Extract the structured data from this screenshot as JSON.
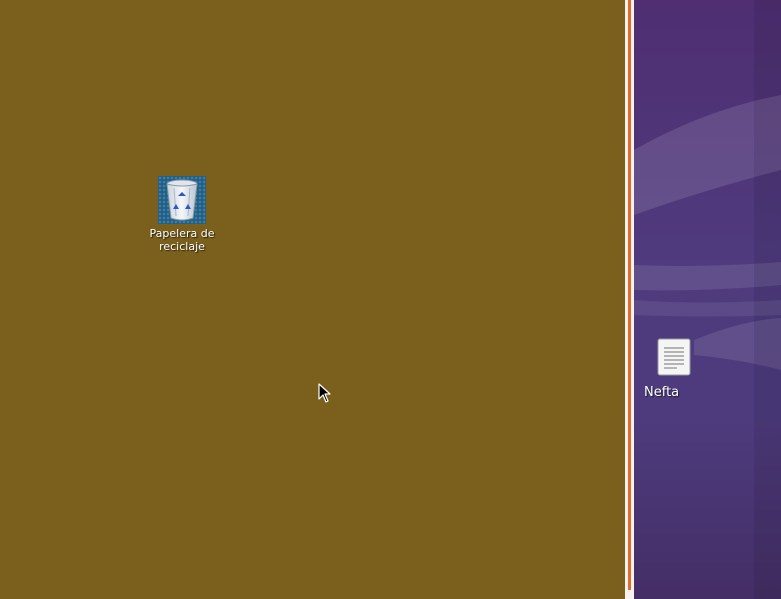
{
  "vm_desktop": {
    "background_color": "#7a5f1d",
    "icons": [
      {
        "label": "Papelera de reciclaje",
        "icon": "recycle-bin-icon"
      }
    ]
  },
  "host_desktop": {
    "background_color": "#4f3b7e",
    "accent_color": "#e06b2b",
    "icons": [
      {
        "label": "Nefta",
        "icon": "text-document-icon"
      }
    ]
  },
  "cursor": {
    "icon": "mouse-pointer-icon"
  }
}
